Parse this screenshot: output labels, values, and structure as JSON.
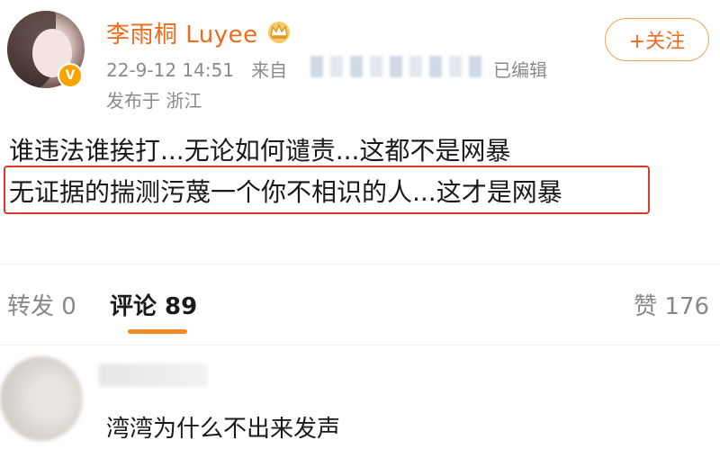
{
  "header": {
    "username": "李雨桐 Luyee",
    "verified_badge": "V",
    "timestamp": "22-9-12 14:51",
    "source_prefix": "来自",
    "edited_label": "已编辑",
    "location": "发布于 浙江",
    "follow_label": "+关注"
  },
  "post": {
    "line1": "谁违法谁挨打...无论如何谴责...这都不是网暴",
    "line2": "无证据的揣测污蔑一个你不相识的人...这才是网暴"
  },
  "tabs": {
    "repost": "转发 0",
    "comments": "评论 89",
    "likes": "赞 176"
  },
  "comments": [
    {
      "text": "湾湾为什么不出来发声"
    }
  ],
  "colors": {
    "accent": "#ee6a1c",
    "highlight_border": "#d93a2b",
    "tab_underline": "#f08a28"
  },
  "icons": {
    "crown": "crown-icon",
    "verified": "verified-badge-icon"
  }
}
